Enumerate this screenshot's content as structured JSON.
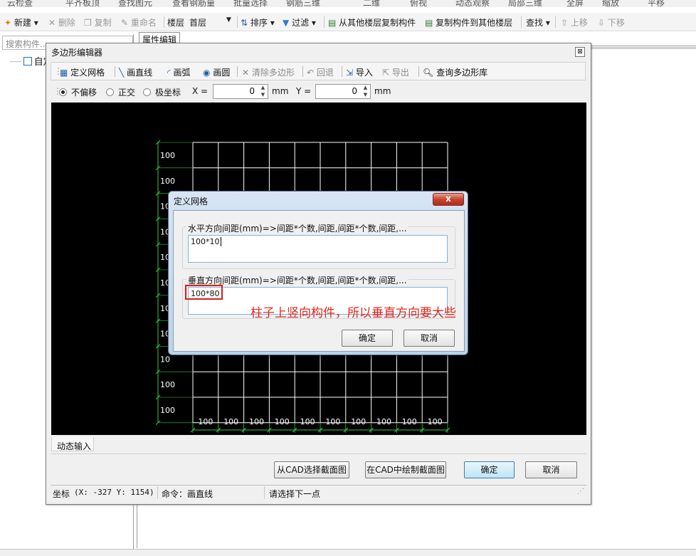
{
  "app_toolbar_top": {
    "items": [
      "云检查",
      "平齐板顶",
      "查找图元",
      "查看钢筋量",
      "批量选择",
      "钢筋三维",
      "二维",
      "俯视",
      "动态观察",
      "局部三维",
      "全屏",
      "缩放",
      "平移"
    ]
  },
  "app_toolbar": {
    "new": "新建",
    "delete": "删除",
    "copy": "复制",
    "rename": "重命名",
    "floor_label": "楼层",
    "floor_value": "首层",
    "sort": "排序",
    "filter": "过滤",
    "copy_from_floors": "从其他楼层复制构件",
    "copy_to_floors": "复制构件到其他楼层",
    "find": "查找",
    "move_up": "上移",
    "move_down": "下移"
  },
  "left_panel": {
    "search_placeholder": "搜索构件...",
    "tree_item": "自定"
  },
  "property_tab": "属性编辑",
  "editor": {
    "title": "多边形编辑器",
    "close_glyph": "⊠",
    "toolbar": {
      "define_grid": "定义网格",
      "draw_line": "画直线",
      "draw_arc": "画弧",
      "draw_circle": "画圆",
      "clear_polygon": "清除多边形",
      "undo": "回退",
      "import": "导入",
      "export": "导出",
      "query_library": "查询多边形库"
    },
    "options": {
      "no_offset": "不偏移",
      "orthogonal": "正交",
      "polar": "极坐标",
      "x_label": "X =",
      "x_value": "0",
      "x_unit": "mm",
      "y_label": "Y =",
      "y_value": "0",
      "y_unit": "mm"
    },
    "grid": {
      "row_labels": [
        "100",
        "100",
        "10",
        "10",
        "10",
        "10",
        "10",
        "10",
        "10",
        "100",
        "100"
      ],
      "col_labels": [
        "100",
        "100",
        "100",
        "100",
        "100",
        "100",
        "100",
        "100",
        "100",
        "100"
      ]
    },
    "dynamic_input_tab": "动态输入",
    "buttons": {
      "select_from_cad": "从CAD选择截面图",
      "draw_in_cad": "在CAD中绘制截面图",
      "ok": "确定",
      "cancel": "取消"
    },
    "status": {
      "coord_label": "坐标",
      "coord_value": "(X: -327 Y: 1154)",
      "command": "命令：画直线",
      "prompt": "请选择下一点"
    }
  },
  "define_grid_dialog": {
    "title": "定义网格",
    "close_label": "x",
    "horizontal_label": "水平方向间距(mm)=>间距*个数,间距,间距*个数,间距,...",
    "horizontal_value": "100*10",
    "vertical_label": "垂直方向间距(mm)=>间距*个数,间距,间距*个数,间距,...",
    "vertical_value": "100*80",
    "ok": "确定",
    "cancel": "取消"
  },
  "annotation": "柱子上竖向构件，所以垂直方向要大些",
  "colors": {
    "canvas_bg": "#000000",
    "grid_line": "#ffffff",
    "dim_line": "#2ecc40",
    "annotation": "#e0281c",
    "dialog_close": "#c5442f",
    "primary_button": "#bfe3f7"
  }
}
